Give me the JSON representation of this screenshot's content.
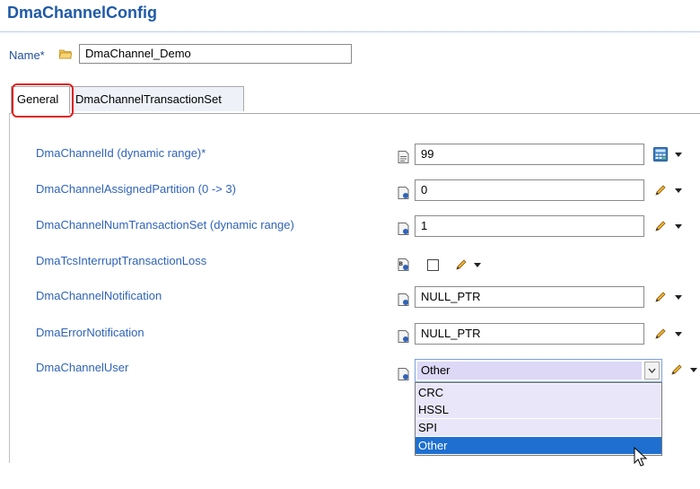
{
  "header": {
    "title": "DmaChannelConfig"
  },
  "name_row": {
    "label": "Name*",
    "value": "DmaChannel_Demo"
  },
  "tabs": [
    {
      "label": "General",
      "active": true
    },
    {
      "label": "DmaChannelTransactionSet",
      "active": false
    }
  ],
  "rows": [
    {
      "label": "DmaChannelId (dynamic range)*",
      "value": "99",
      "tool_icon": "calculator-icon"
    },
    {
      "label": "DmaChannelAssignedPartition (0 -> 3)",
      "value": "0",
      "tool_icon": "pencil-icon"
    },
    {
      "label": "DmaChannelNumTransactionSet (dynamic range)",
      "value": "1",
      "tool_icon": "pencil-icon"
    },
    {
      "label": "DmaTcsInterruptTransactionLoss",
      "value": "",
      "checked": false,
      "tool_icon": "pencil-icon"
    },
    {
      "label": "DmaChannelNotification",
      "value": "NULL_PTR",
      "tool_icon": "pencil-icon"
    },
    {
      "label": "DmaErrorNotification",
      "value": "NULL_PTR",
      "tool_icon": "pencil-icon"
    },
    {
      "label": "DmaChannelUser",
      "value": "Other",
      "tool_icon": "pencil-icon"
    }
  ],
  "dropdown": {
    "options": [
      "CRC",
      "HSSL",
      "SPI",
      "Other"
    ],
    "selected": "Other"
  },
  "colors": {
    "title": "#1f5aa8",
    "label": "#2f63b8",
    "highlight_box": "#e0201e",
    "selection": "#1e6fd0"
  }
}
